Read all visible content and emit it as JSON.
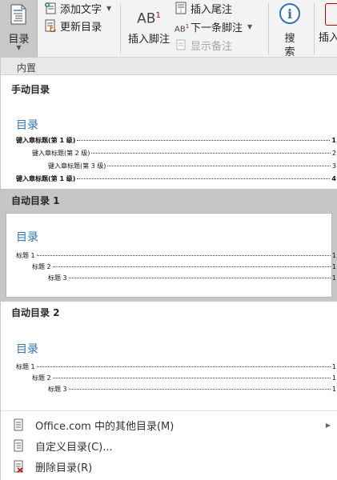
{
  "ribbon": {
    "toc_label": "目录",
    "add_text": "添加文字",
    "update_toc": "更新目录",
    "insert_footnote": "插入脚注",
    "insert_endnote": "插入尾注",
    "next_footnote": "下一条脚注",
    "show_notes": "显示备注",
    "search": "搜索",
    "insert_partial": "插入",
    "footnote_icon_text": "AB",
    "footnote_superscript": "1",
    "next_icon_text": "AB",
    "next_icon_super": "1",
    "search_icon_glyph": "i"
  },
  "gallery": {
    "section_header": "内置",
    "manual": {
      "title": "手动目录",
      "preview_title": "目录",
      "lines": [
        {
          "text": "键入章标题(第 1 级)",
          "page": "1",
          "level": 1,
          "bold": true
        },
        {
          "text": "键入章标题(第 2 级)",
          "page": "2",
          "level": 2,
          "bold": false
        },
        {
          "text": "键入章标题(第 3 级)",
          "page": "3",
          "level": 3,
          "bold": false
        },
        {
          "text": "键入章标题(第 1 级)",
          "page": "4",
          "level": 1,
          "bold": true
        }
      ]
    },
    "auto1": {
      "title": "自动目录 1",
      "preview_title": "目录",
      "lines": [
        {
          "text": "标题 1",
          "page": "1",
          "level": 1
        },
        {
          "text": "标题 2",
          "page": "1",
          "level": 2
        },
        {
          "text": "标题 3",
          "page": "1",
          "level": 3
        }
      ]
    },
    "auto2": {
      "title": "自动目录 2",
      "preview_title": "目录",
      "lines": [
        {
          "text": "标题 1",
          "page": "1",
          "level": 1
        },
        {
          "text": "标题 2",
          "page": "1",
          "level": 2
        },
        {
          "text": "标题 3",
          "page": "1",
          "level": 3
        }
      ]
    }
  },
  "menu": {
    "more_toc": "Office.com 中的其他目录(M)",
    "custom_toc": "自定义目录(C)...",
    "remove_toc": "删除目录(R)"
  },
  "colors": {
    "accent_blue": "#2e74b5",
    "ribbon_bg": "#f3f3f3",
    "selected_bg": "#c6c6c6"
  }
}
